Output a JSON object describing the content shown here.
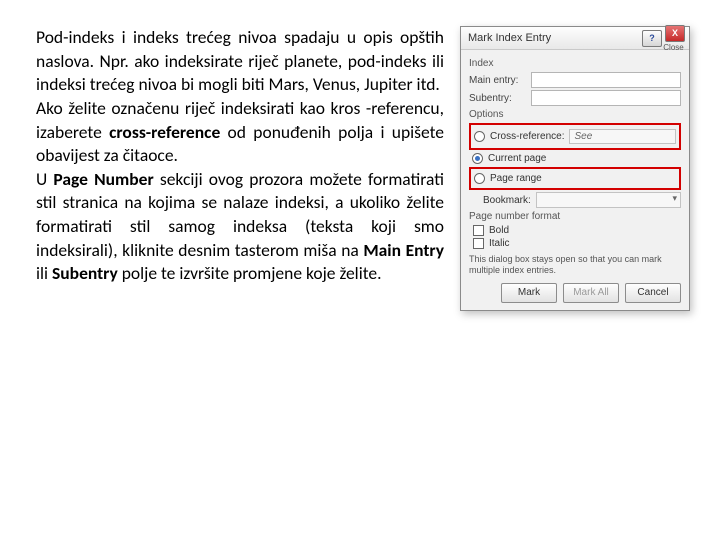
{
  "text": {
    "p1a": "Pod-indeks i indeks trećeg nivoa spadaju u opis opštih naslova. Npr. ako indeksirate riječ planete, pod-indeks ili indeksi trećeg nivoa bi mogli biti Mars, Venus, Jupiter itd.",
    "p2a": "Ako želite označenu riječ indeksirati kao kros -referencu, izaberete ",
    "p2b": "cross-reference",
    "p2c": " od ponuđenih polja i upišete obavijest za čitaoce.",
    "p3a": "U ",
    "p3b": "Page Number",
    "p3c": " sekciji ovog prozora možete formatirati stil stranica na kojima se nalaze indeksi, a ukoliko želite formatirati stil samog indeksa (teksta koji smo indeksirali), kliknite desnim tasterom miša na ",
    "p3d": "Main Entry",
    "p3e": " ili ",
    "p3f": "Subentry",
    "p3g": " polje te izvršite promjene koje želite."
  },
  "dialog": {
    "title": "Mark Index Entry",
    "help": "?",
    "close": "X",
    "close_label": "Close",
    "index_label": "Index",
    "main_entry": "Main entry:",
    "subentry": "Subentry:",
    "options_label": "Options",
    "cross_ref": "Cross-reference:",
    "cross_ref_value": "See",
    "current_page": "Current page",
    "page_range": "Page range",
    "bookmark": "Bookmark:",
    "page_format": "Page number format",
    "bold": "Bold",
    "italic": "Italic",
    "note": "This dialog box stays open so that you can mark multiple index entries.",
    "mark": "Mark",
    "mark_all": "Mark All",
    "cancel": "Cancel"
  }
}
